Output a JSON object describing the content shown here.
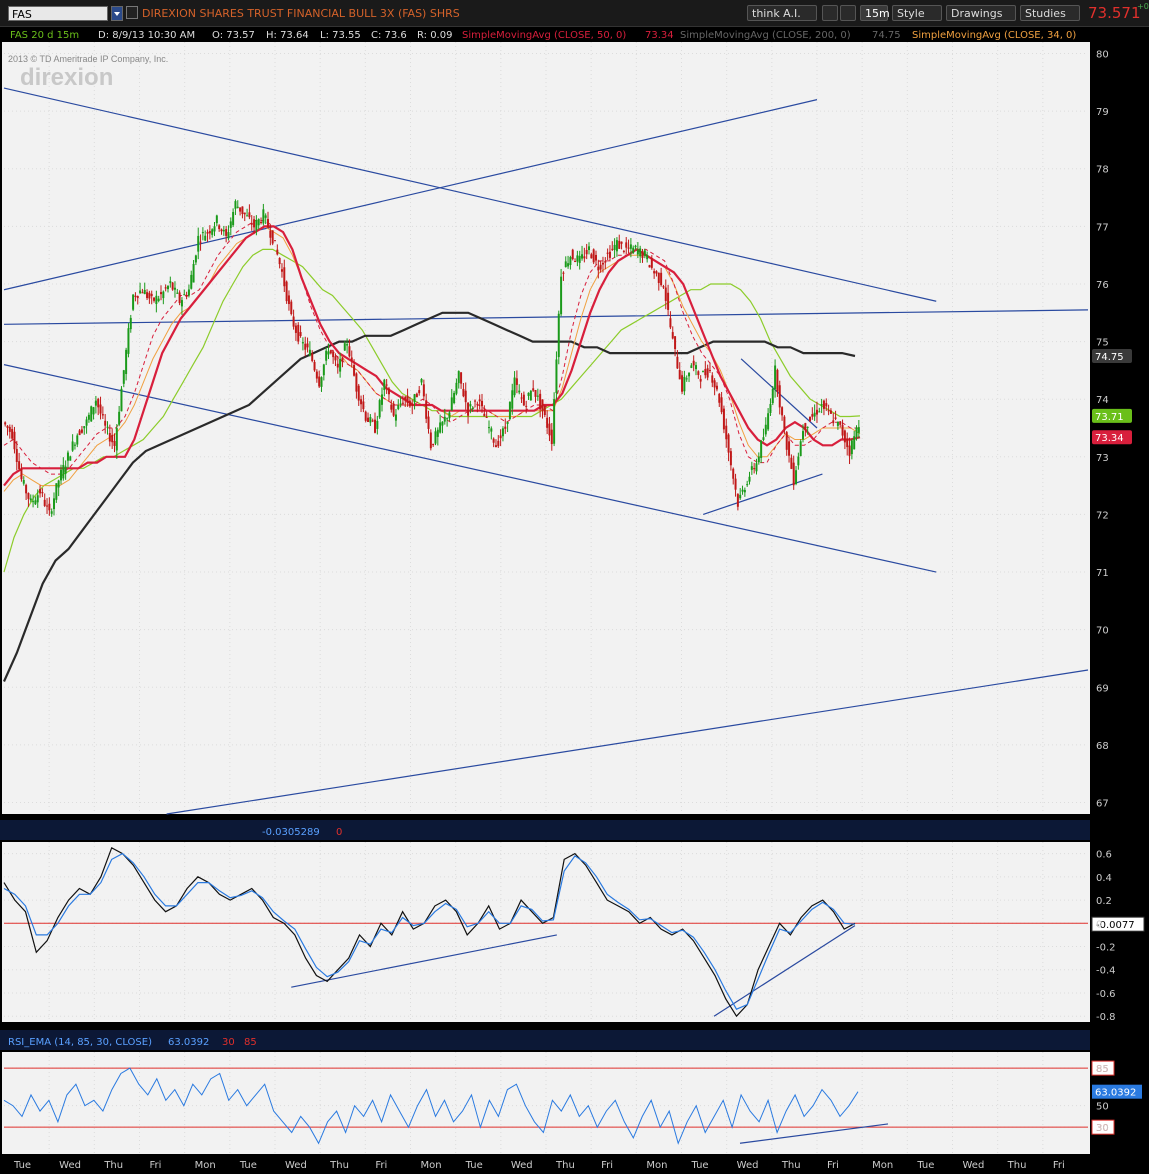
{
  "toolbar": {
    "symbol": "FAS",
    "description": "DIREXION SHARES TRUST FINANCIAL BULL 3X (FAS) SHRS",
    "think_label": "think A.I.",
    "interval_label": "15m",
    "style_label": "Style",
    "drawings_label": "Drawings",
    "studies_label": "Studies",
    "last_price": "73.571",
    "last_change": "+0",
    "colors": {
      "price_red": "#e0302c",
      "accent_orange": "#d4622a"
    }
  },
  "header": {
    "chart_label": "FAS 20 d 15m",
    "date": "D: 8/9/13 10:30 AM",
    "open": "O: 73.57",
    "high": "H: 73.64",
    "low": "L: 73.55",
    "close": "C: 73.6",
    "range": "R: 0.09",
    "sma50_label": "SimpleMovingAvg (CLOSE, 50, 0)",
    "sma50_value": "73.34",
    "sma200_label": "SimpleMovingAvg (CLOSE, 200, 0)",
    "sma200_value": "74.75",
    "sma34_label": "SimpleMovingAvg (CLOSE, 34, 0)"
  },
  "watermark": {
    "copyright": "2013 © TD Ameritrade IP Company, Inc.",
    "logo": "direxion"
  },
  "macd_header": {
    "value1": "-0.0305289",
    "value2": "0"
  },
  "rsi_header": {
    "label": "RSI_EMA (14, 85, 30, CLOSE)",
    "value": "63.0392",
    "lower": "30",
    "upper": "85"
  },
  "chart_data": [
    {
      "type": "candlestick",
      "panel": "price",
      "ylim": [
        66.8,
        80.2
      ],
      "yticks": [
        "67",
        "68",
        "69",
        "70",
        "71",
        "72",
        "73",
        "74",
        "75",
        "76",
        "77",
        "78",
        "79",
        "80"
      ],
      "price_labels": [
        {
          "text": "74.75",
          "y": 74.75,
          "color": "#3a3a3a"
        },
        {
          "text": "73.71",
          "y": 73.71,
          "color": "#6abf1a"
        },
        {
          "text": "73.34",
          "y": 73.34,
          "color": "#d81f3c"
        }
      ],
      "x_days": [
        "Tue",
        "Wed",
        "Thu",
        "Fri",
        "Mon",
        "Tue",
        "Wed",
        "Thu",
        "Fri",
        "Mon",
        "Tue",
        "Wed",
        "Thu",
        "Fri",
        "Mon",
        "Tue",
        "Wed",
        "Thu",
        "Fri",
        "Mon",
        "Tue",
        "Wed",
        "Thu",
        "Fri"
      ],
      "close_path": [
        73.6,
        73.4,
        72.6,
        72.2,
        72.4,
        72.0,
        72.6,
        73.0,
        73.4,
        73.6,
        74.0,
        73.5,
        73.2,
        74.5,
        75.8,
        75.9,
        75.7,
        75.8,
        76.0,
        75.7,
        75.9,
        76.8,
        76.9,
        77.1,
        76.8,
        77.4,
        77.2,
        77.0,
        77.2,
        76.8,
        76.2,
        75.4,
        75.0,
        74.8,
        74.3,
        74.9,
        74.5,
        75.0,
        74.2,
        73.7,
        73.5,
        74.3,
        73.7,
        74.0,
        73.9,
        74.3,
        73.2,
        73.5,
        73.8,
        74.4,
        73.8,
        74.0,
        73.6,
        73.2,
        73.5,
        74.3,
        73.9,
        74.2,
        73.8,
        73.3,
        76.2,
        76.5,
        76.4,
        76.6,
        76.3,
        76.5,
        76.7,
        76.6,
        76.6,
        76.5,
        76.2,
        76.0,
        75.0,
        74.2,
        74.6,
        74.4,
        74.5,
        74.0,
        73.1,
        72.2,
        72.6,
        72.9,
        73.5,
        74.5,
        73.4,
        72.6,
        73.5,
        73.7,
        73.9,
        73.7,
        73.5,
        73.1,
        73.6
      ],
      "sma_fast": [
        73.2,
        73.3,
        73.1,
        72.9,
        72.8,
        72.7,
        72.7,
        72.8,
        73.0,
        73.2,
        73.4,
        73.5,
        73.5,
        73.7,
        74.1,
        74.6,
        75.1,
        75.4,
        75.6,
        75.8,
        75.8,
        75.9,
        76.2,
        76.5,
        76.7,
        76.9,
        77.0,
        77.1,
        77.1,
        77.0,
        76.9,
        76.6,
        76.1,
        75.6,
        75.2,
        74.9,
        74.7,
        74.6,
        74.5,
        74.3,
        74.1,
        74.0,
        73.9,
        73.9,
        73.9,
        74.0,
        73.9,
        73.7,
        73.6,
        73.7,
        73.8,
        73.9,
        73.8,
        73.7,
        73.6,
        73.7,
        73.8,
        73.9,
        73.9,
        73.8,
        74.4,
        75.2,
        75.8,
        76.2,
        76.4,
        76.4,
        76.5,
        76.5,
        76.6,
        76.6,
        76.5,
        76.4,
        76.0,
        75.5,
        75.1,
        74.8,
        74.6,
        74.4,
        74.0,
        73.4,
        73.0,
        72.9,
        72.9,
        73.2,
        73.4,
        73.2,
        73.2,
        73.3,
        73.5,
        73.6,
        73.6,
        73.5,
        73.5
      ],
      "sma34": [
        72.4,
        72.6,
        72.7,
        72.6,
        72.5,
        72.5,
        72.5,
        72.6,
        72.8,
        73.0,
        73.2,
        73.3,
        73.4,
        73.6,
        73.9,
        74.3,
        74.7,
        75.0,
        75.3,
        75.5,
        75.6,
        75.8,
        76.0,
        76.3,
        76.5,
        76.7,
        76.8,
        76.9,
        77.0,
        76.9,
        76.8,
        76.5,
        76.1,
        75.7,
        75.3,
        75.0,
        74.8,
        74.6,
        74.5,
        74.3,
        74.1,
        74.0,
        73.9,
        73.9,
        73.9,
        73.9,
        73.9,
        73.8,
        73.7,
        73.8,
        73.8,
        73.8,
        73.8,
        73.7,
        73.7,
        73.7,
        73.8,
        73.8,
        73.8,
        73.8,
        74.2,
        74.8,
        75.4,
        75.9,
        76.2,
        76.3,
        76.4,
        76.5,
        76.5,
        76.5,
        76.4,
        76.3,
        76.0,
        75.6,
        75.3,
        75.0,
        74.8,
        74.5,
        74.1,
        73.6,
        73.2,
        73.0,
        73.0,
        73.2,
        73.4,
        73.3,
        73.3,
        73.4,
        73.5,
        73.5,
        73.5,
        73.5,
        73.4
      ],
      "sma50_red": [
        72.5,
        72.7,
        72.8,
        72.8,
        72.8,
        72.8,
        72.8,
        72.8,
        72.8,
        72.9,
        72.9,
        73.0,
        73.0,
        73.0,
        73.3,
        73.8,
        74.3,
        74.8,
        75.1,
        75.4,
        75.6,
        75.8,
        76.0,
        76.2,
        76.4,
        76.6,
        76.8,
        76.9,
        77.0,
        77.0,
        76.9,
        76.6,
        76.1,
        75.7,
        75.3,
        75.0,
        74.8,
        74.7,
        74.6,
        74.5,
        74.4,
        74.2,
        74.1,
        74.0,
        73.9,
        73.9,
        73.9,
        73.8,
        73.8,
        73.8,
        73.8,
        73.8,
        73.8,
        73.8,
        73.8,
        73.8,
        73.8,
        73.8,
        73.9,
        73.9,
        74.1,
        74.5,
        75.0,
        75.5,
        75.9,
        76.2,
        76.4,
        76.5,
        76.6,
        76.5,
        76.4,
        76.3,
        76.2,
        76.0,
        75.6,
        75.2,
        74.8,
        74.4,
        74.1,
        73.8,
        73.5,
        73.3,
        73.2,
        73.3,
        73.5,
        73.6,
        73.5,
        73.3,
        73.2,
        73.2,
        73.3,
        73.3,
        73.34
      ],
      "sma50_green": [
        71.0,
        71.6,
        72.0,
        72.3,
        72.5,
        72.6,
        72.7,
        72.8,
        72.8,
        72.9,
        73.0,
        73.0,
        73.1,
        73.2,
        73.3,
        73.5,
        73.7,
        74.0,
        74.3,
        74.6,
        74.9,
        75.3,
        75.7,
        76.0,
        76.3,
        76.5,
        76.6,
        76.6,
        76.5,
        76.4,
        76.3,
        76.1,
        75.9,
        75.8,
        75.6,
        75.4,
        75.2,
        74.9,
        74.6,
        74.3,
        74.1,
        74.0,
        73.9,
        73.8,
        73.8,
        73.7,
        73.7,
        73.7,
        73.7,
        73.7,
        73.7,
        73.7,
        73.7,
        73.7,
        73.8,
        73.9,
        74.0,
        74.2,
        74.4,
        74.6,
        74.8,
        75.0,
        75.2,
        75.3,
        75.4,
        75.5,
        75.6,
        75.7,
        75.8,
        75.9,
        75.9,
        76.0,
        76.0,
        76.0,
        75.9,
        75.7,
        75.4,
        75.0,
        74.7,
        74.4,
        74.2,
        74.0,
        73.9,
        73.8,
        73.7,
        73.7,
        73.71
      ],
      "sma200": [
        69.1,
        69.6,
        70.2,
        70.8,
        71.2,
        71.4,
        71.7,
        72.0,
        72.3,
        72.6,
        72.9,
        73.1,
        73.2,
        73.3,
        73.4,
        73.5,
        73.6,
        73.7,
        73.8,
        73.9,
        74.1,
        74.3,
        74.5,
        74.7,
        74.8,
        74.9,
        75.0,
        75.0,
        75.1,
        75.1,
        75.1,
        75.2,
        75.3,
        75.4,
        75.5,
        75.5,
        75.5,
        75.4,
        75.3,
        75.2,
        75.1,
        75.0,
        75.0,
        75.0,
        75.0,
        74.9,
        74.9,
        74.8,
        74.8,
        74.8,
        74.8,
        74.8,
        74.8,
        74.8,
        74.9,
        75.0,
        75.0,
        75.0,
        75.0,
        75.0,
        74.9,
        74.9,
        74.8,
        74.8,
        74.8,
        74.8,
        74.75
      ],
      "trendlines": [
        {
          "from": [
            0,
            75.9
          ],
          "to": [
            0.75,
            79.2
          ]
        },
        {
          "from": [
            0,
            79.4
          ],
          "to": [
            0.86,
            75.7
          ]
        },
        {
          "from": [
            0,
            75.3
          ],
          "to": [
            1,
            75.55
          ]
        },
        {
          "from": [
            0,
            74.6
          ],
          "to": [
            0.86,
            71.0
          ]
        },
        {
          "from": [
            0.15,
            66.8
          ],
          "to": [
            1,
            69.3
          ]
        },
        {
          "from": [
            0.645,
            72.0
          ],
          "to": [
            0.755,
            72.7
          ]
        },
        {
          "from": [
            0.68,
            74.7
          ],
          "to": [
            0.75,
            73.5
          ]
        }
      ]
    },
    {
      "type": "line",
      "panel": "macd",
      "ylim": [
        -0.85,
        0.7
      ],
      "yticks": [
        "0.6",
        "0.4",
        "0.2",
        "0",
        "-0.2",
        "-0.4",
        "-0.6",
        "-0.8"
      ],
      "current_label": "-0.0077",
      "value_series": [
        0.35,
        0.2,
        0.1,
        -0.25,
        -0.15,
        0.05,
        0.2,
        0.3,
        0.25,
        0.4,
        0.65,
        0.6,
        0.5,
        0.35,
        0.2,
        0.1,
        0.15,
        0.3,
        0.4,
        0.35,
        0.25,
        0.2,
        0.25,
        0.3,
        0.2,
        0.05,
        0.0,
        -0.1,
        -0.3,
        -0.45,
        -0.5,
        -0.4,
        -0.3,
        -0.1,
        -0.2,
        0.0,
        -0.1,
        0.1,
        -0.05,
        0.0,
        0.15,
        0.2,
        0.1,
        -0.1,
        0.0,
        0.15,
        -0.05,
        0.0,
        0.2,
        0.1,
        0.0,
        0.05,
        0.55,
        0.6,
        0.5,
        0.35,
        0.2,
        0.15,
        0.1,
        0.0,
        0.05,
        -0.05,
        -0.1,
        -0.05,
        -0.15,
        -0.3,
        -0.45,
        -0.65,
        -0.8,
        -0.7,
        -0.4,
        -0.2,
        0.0,
        -0.1,
        0.05,
        0.15,
        0.2,
        0.1,
        -0.05,
        0.0
      ],
      "signal_series": [
        0.3,
        0.25,
        0.15,
        -0.1,
        -0.1,
        0.0,
        0.15,
        0.25,
        0.25,
        0.35,
        0.55,
        0.6,
        0.52,
        0.4,
        0.25,
        0.15,
        0.15,
        0.25,
        0.35,
        0.35,
        0.28,
        0.22,
        0.24,
        0.28,
        0.22,
        0.1,
        0.02,
        -0.05,
        -0.22,
        -0.38,
        -0.46,
        -0.42,
        -0.33,
        -0.15,
        -0.18,
        -0.05,
        -0.08,
        0.05,
        -0.02,
        0.0,
        0.1,
        0.17,
        0.12,
        -0.03,
        0.0,
        0.1,
        0.0,
        0.0,
        0.15,
        0.12,
        0.02,
        0.03,
        0.45,
        0.58,
        0.52,
        0.4,
        0.25,
        0.18,
        0.12,
        0.03,
        0.04,
        -0.02,
        -0.08,
        -0.06,
        -0.12,
        -0.25,
        -0.4,
        -0.58,
        -0.74,
        -0.7,
        -0.48,
        -0.26,
        -0.05,
        -0.08,
        0.02,
        0.12,
        0.18,
        0.12,
        0.0,
        -0.0077
      ],
      "zero_line": 0,
      "trendlines": [
        {
          "from": [
            0.265,
            -0.55
          ],
          "to": [
            0.51,
            -0.1
          ]
        },
        {
          "from": [
            0.655,
            -0.8
          ],
          "to": [
            0.785,
            -0.02
          ]
        }
      ]
    },
    {
      "type": "line",
      "panel": "rsi",
      "ylim": [
        5,
        100
      ],
      "yticks": [
        "85",
        "50",
        "30"
      ],
      "current_label": "63.0392",
      "overbought": 85,
      "oversold": 30,
      "series": [
        55,
        50,
        40,
        60,
        45,
        55,
        35,
        60,
        70,
        50,
        55,
        45,
        65,
        80,
        85,
        70,
        60,
        75,
        55,
        65,
        50,
        70,
        60,
        75,
        80,
        55,
        65,
        50,
        60,
        70,
        45,
        35,
        25,
        40,
        30,
        15,
        35,
        45,
        25,
        50,
        40,
        55,
        35,
        60,
        45,
        30,
        50,
        65,
        40,
        55,
        35,
        45,
        60,
        30,
        55,
        40,
        65,
        70,
        50,
        35,
        25,
        55,
        45,
        60,
        40,
        50,
        30,
        45,
        55,
        35,
        20,
        40,
        55,
        30,
        45,
        15,
        35,
        50,
        25,
        40,
        55,
        30,
        60,
        45,
        35,
        55,
        25,
        45,
        60,
        40,
        50,
        65,
        55,
        40,
        50,
        63
      ]
    }
  ]
}
